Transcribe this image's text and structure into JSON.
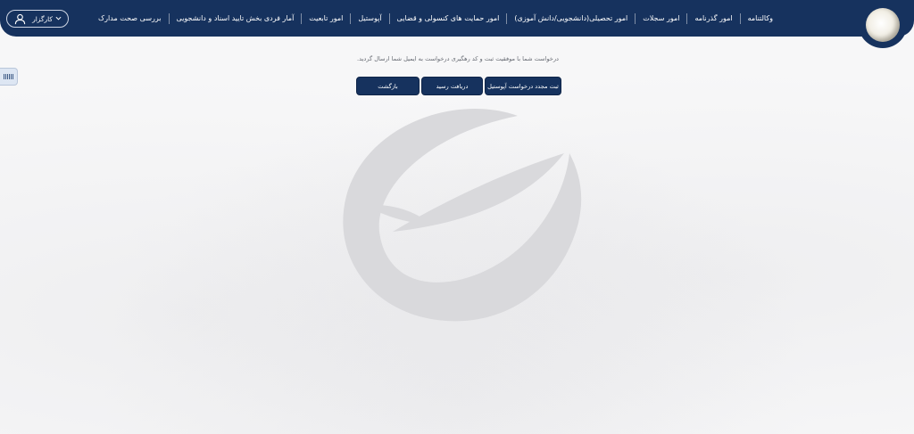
{
  "header": {
    "nav_items": [
      "وکالتنامه",
      "امور گذرنامه",
      "امور سجلات",
      "امور تحصیلی(دانشجویی/دانش آموزی)",
      "امور حمایت های کنسولی و قضایی",
      "آپوستیل",
      "امور تابعیت",
      "آمار فردی بخش تایید اسناد و دانشجویی",
      "بررسی صحت مدارک"
    ],
    "user_label": "کارگزار"
  },
  "main": {
    "message": "درخواست شما با موفقیت ثبت و کد رهگیری درخواست به ایمیل شما ارسال گردید.",
    "buttons": {
      "new_request": "ثبت مجدد درخواست آپوستیل",
      "receipt": "دریافت رسید",
      "back": "بازگشت"
    }
  },
  "colors": {
    "navbar": "#16325e",
    "button": "#16325e",
    "watermark": "#d9d9dc"
  }
}
